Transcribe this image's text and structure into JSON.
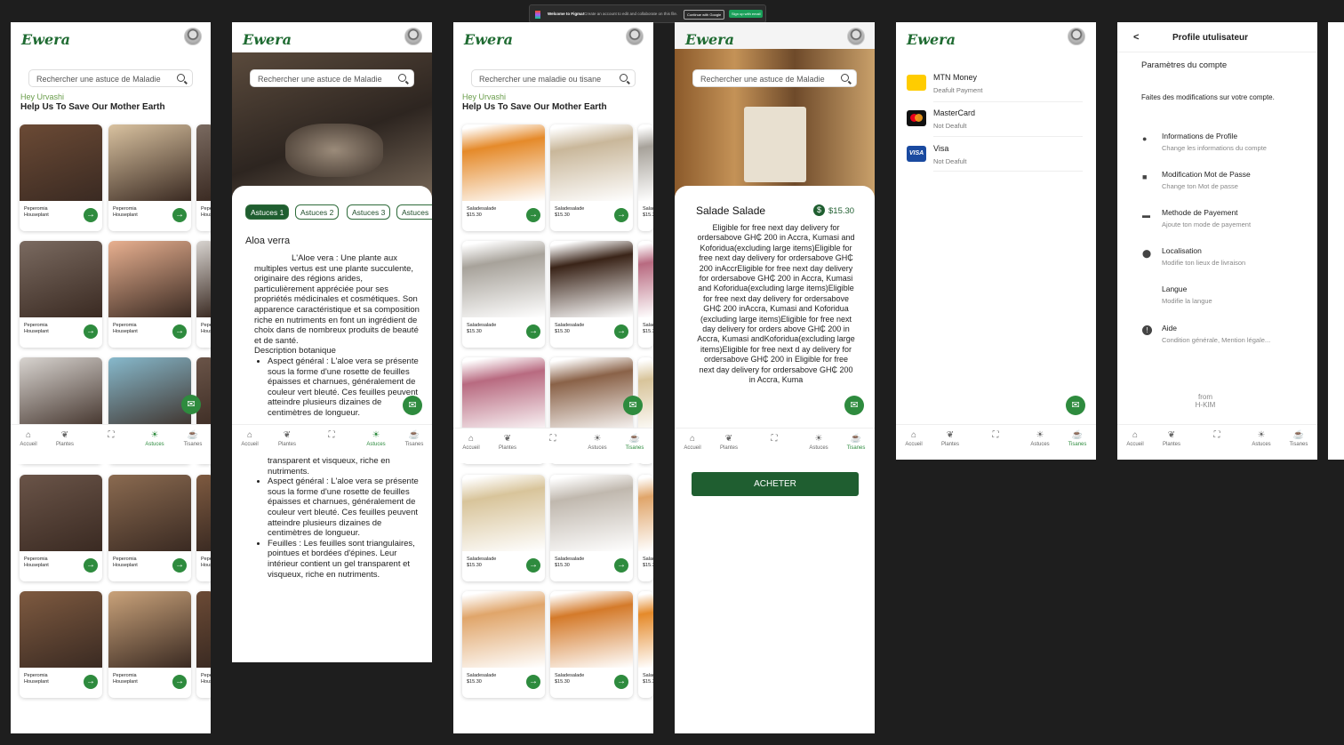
{
  "figma_banner": {
    "title": "Welcome to Figma!",
    "text": "Create an account to edit and collaborate on this file.",
    "google_btn": "Continue with Google",
    "email_btn": "Sign up with email"
  },
  "brand": "Ewera",
  "colors": {
    "primary": "#2e8b3e",
    "dark": "#1f5e30",
    "accent_text": "#6a9d4b"
  },
  "home": {
    "search_placeholder": "Rechercher une astuce de Maladie",
    "hey": "Hey Urvashi",
    "help": "Help Us To Save Our Mother Earth",
    "card_title": "Peperomia",
    "card_sub": "Houseplant"
  },
  "nav": {
    "home": "Accueil",
    "plants": "Plantes",
    "tips": "Astuces",
    "teas": "Tisanes"
  },
  "tips": {
    "search_placeholder": "Rechercher une astuce de Maladie",
    "tabs": [
      "Astuces 1",
      "Astuces 2",
      "Astuces 3",
      "Astuces"
    ],
    "title": "Aloa verra",
    "intro": "L'Aloe vera : Une plante aux multiples vertus est une plante succulente, originaire des régions arides, particulièrement appréciée pour ses propriétés médicinales et cosmétiques. Son apparence caractéristique et sa composition riche en nutriments en font un ingrédient de choix dans de nombreux produits de beauté et de santé.",
    "desc": "Description botanique",
    "bullet1": "Aspect général : L'aloe vera se présente sous la forme d'une rosette de feuilles épaisses et charnues, généralement de couleur vert bleuté. Ces feuilles peuvent atteindre plusieurs dizaines de centimètres de longueur.",
    "overflow_tail": "transparent et visqueux, riche en nutriments.",
    "bullet2": "Aspect général : L'aloe vera se présente sous la forme d'une rosette de feuilles épaisses et charnues, généralement de couleur vert bleuté. Ces feuilles peuvent atteindre plusieurs dizaines de centimètres de longueur.",
    "bullet3": "Feuilles : Les feuilles sont triangulaires, pointues et bordées d'épines. Leur intérieur contient un gel transparent et visqueux, riche en nutriments."
  },
  "shop": {
    "search_placeholder": "Rechercher une maladie ou tisane",
    "hey": "Hey Urvashi",
    "help": "Help Us To Save Our Mother Earth",
    "product": "Saladesalade",
    "price": "$15.30"
  },
  "product": {
    "search_placeholder": "Rechercher une astuce de Maladie",
    "name": "Salade Salade",
    "price": "$15.30",
    "description": "Eligible for free next day delivery for ordersabove GH₵ 200 in Accra, Kumasi and Koforidua(excluding large items)Eligible for free next day delivery for ordersabove GH₵ 200 inAccrEligible for free next day delivery for ordersabove GH₵ 200 in Accra, Kumasi and Koforidua(excluding large items)Eligible for free next day delivery for ordersabove GH₵ 200 inAccra, Kumasi and Koforidua (excluding large items)Eligible for free next day delivery for orders above GH₵ 200 in Accra, Kumasi andKoforidua(excluding large items)Eligible for free next d ay delivery for ordersabove GH₵ 200 in Eligible for free next day delivery for ordersabove GH₵ 200 in Accra, Kuma",
    "buy": "ACHETER"
  },
  "payment": {
    "methods": [
      {
        "name": "MTN Money",
        "sub": "Deafult Payment"
      },
      {
        "name": "MasterCard",
        "sub": "Not Deafult"
      },
      {
        "name": "Visa",
        "sub": "Not Deafult"
      }
    ]
  },
  "profile": {
    "back": "<",
    "title": "Profile utulisateur",
    "section": "Paramètres du compte",
    "intro": "Faites des modifications sur votre compte.",
    "items": [
      {
        "name": "Informations de Profile",
        "sub": "Change les informations du compte"
      },
      {
        "name": "Modification Mot de Passe",
        "sub": "Change ton Mot de passe"
      },
      {
        "name": "Methode de Payement",
        "sub": "Ajoute ton mode de payement"
      },
      {
        "name": "Localisation",
        "sub": "Modifie ton lieux de livraison"
      },
      {
        "name": "Langue",
        "sub": "Modifie la langue"
      },
      {
        "name": "Aide",
        "sub": "Condition générale, Mention légale..."
      }
    ],
    "from": "from",
    "company": "H-KIM"
  }
}
